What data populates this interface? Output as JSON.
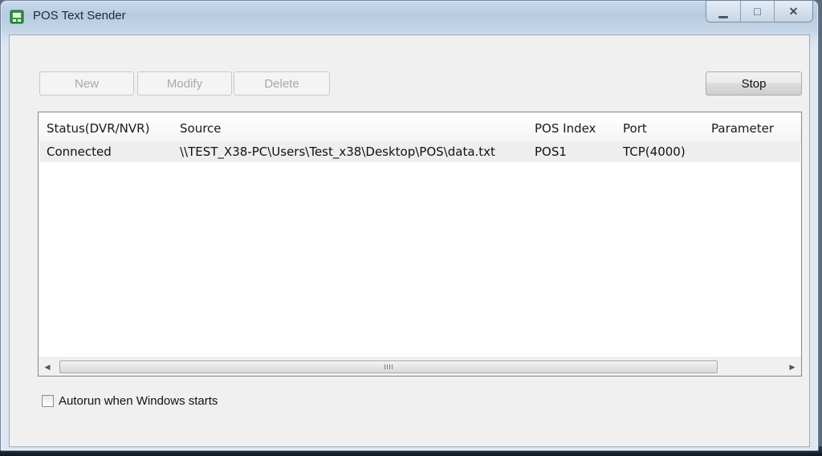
{
  "window": {
    "title": "POS Text Sender",
    "controls": {
      "minimize": "▁",
      "maximize": "□",
      "close": "✕"
    }
  },
  "toolbar": {
    "new_label": "New",
    "modify_label": "Modify",
    "delete_label": "Delete",
    "stop_label": "Stop"
  },
  "table": {
    "columns": [
      "Status(DVR/NVR)",
      "Source",
      "POS Index",
      "Port",
      "Parameter"
    ],
    "rows": [
      {
        "status": "Connected",
        "source": "\\\\TEST_X38-PC\\Users\\Test_x38\\Desktop\\POS\\data.txt",
        "pos_index": "POS1",
        "port": "TCP(4000)",
        "parameter": ""
      }
    ]
  },
  "options": {
    "autorun_label": "Autorun when Windows starts",
    "autorun_checked": false
  },
  "icons": {
    "app": "pos-sender-icon",
    "scroll_left": "scroll-left-arrow-icon",
    "scroll_right": "scroll-right-arrow-icon"
  },
  "colors": {
    "titlebar": "#c6d6e8",
    "client": "#f0f0f0",
    "row_selected": "#eeeeee",
    "app_icon_green": "#2e9a3a"
  }
}
